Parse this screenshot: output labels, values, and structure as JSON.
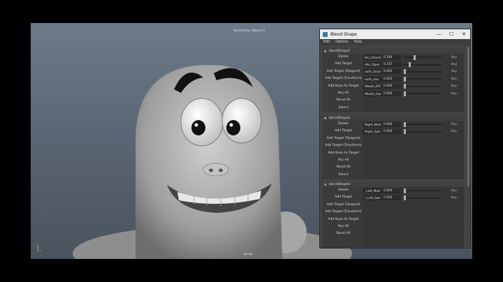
{
  "viewport": {
    "title": "Symmetry: Object X",
    "camera": "persp",
    "colors": {
      "bg_top": "#6d7a89",
      "bg_bottom": "#4a535e",
      "character": "#b8b8b8"
    }
  },
  "window": {
    "title": "Blend Shape",
    "icon": "maya-app-icon",
    "controls": {
      "minimize": "—",
      "maximize": "☐",
      "close": "✕"
    }
  },
  "menu": [
    "Edit",
    "Options",
    "Help"
  ],
  "nodes": [
    {
      "name": "blendShape1",
      "commands": [
        "Delete",
        "Add Target",
        "Add Target (Tangent)",
        "Add Target (Transform)",
        "Add Base As Target",
        "Key All",
        "Reset All",
        "Select"
      ],
      "targets": [
        {
          "name": "Ilis_Closed",
          "value": "0.284",
          "slider": 0.284,
          "key": "Key"
        },
        {
          "name": "Idle_Open",
          "value": "0.147",
          "slider": 0.147,
          "key": "Key"
        },
        {
          "name": "outh_Snarl",
          "value": "0.002",
          "slider": 0.002,
          "key": "Key"
        },
        {
          "name": "outh_ooo",
          "value": "0.000",
          "slider": 0.0,
          "key": "Key"
        },
        {
          "name": "Mouth_EFF",
          "value": "0.000",
          "slider": 0.0,
          "key": "Key"
        },
        {
          "name": "Mouth_Gen",
          "value": "0.000",
          "slider": 0.0,
          "key": "Key"
        }
      ]
    },
    {
      "name": "blendShape2",
      "commands": [
        "Delete",
        "Add Target",
        "Add Target (Tangent)",
        "Add Target (Transform)",
        "Add Base As Target",
        "Key All",
        "Reset All",
        "Select"
      ],
      "targets": [
        {
          "name": "Right_Mad",
          "value": "0.000",
          "slider": 0.0,
          "key": "Key"
        },
        {
          "name": "Right_Sad",
          "value": "0.000",
          "slider": 0.0,
          "key": "Key"
        }
      ]
    },
    {
      "name": "blendShape3",
      "commands": [
        "Delete",
        "Add Target",
        "Add Target (Tangent)",
        "Add Target (Transform)",
        "Add Base As Target",
        "Key All",
        "Reset All"
      ],
      "targets": [
        {
          "name": "_Left_Mad",
          "value": "0.000",
          "slider": 0.0,
          "key": "Key"
        },
        {
          "name": "i_Left_Sad",
          "value": "0.000",
          "slider": 0.0,
          "key": "Key"
        }
      ]
    }
  ]
}
